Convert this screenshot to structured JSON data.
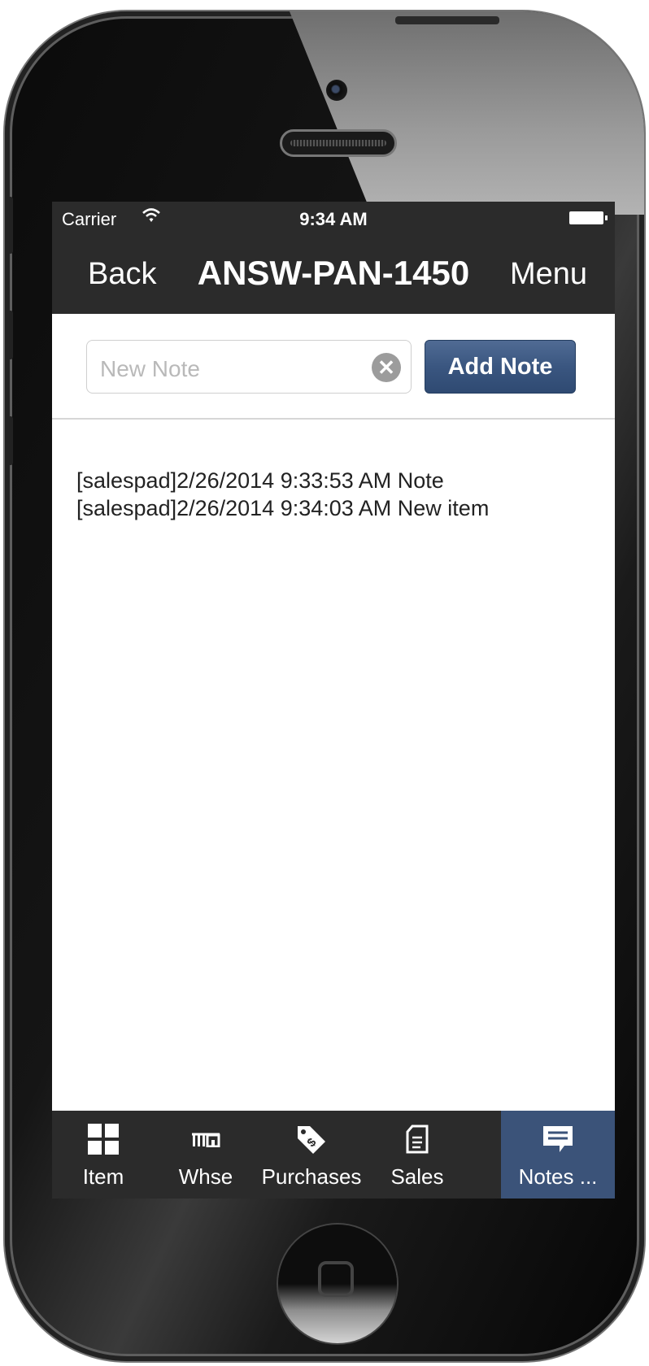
{
  "status_bar": {
    "carrier": "Carrier",
    "time": "9:34 AM"
  },
  "nav": {
    "back_label": "Back",
    "title": "ANSW-PAN-1450",
    "menu_label": "Menu"
  },
  "note_form": {
    "placeholder": "New Note",
    "clear_icon": "clear-icon",
    "add_label": "Add Note"
  },
  "notes": [
    "[salespad]2/26/2014 9:33:53 AM Note",
    "[salespad]2/26/2014 9:34:03 AM New item"
  ],
  "tabs": [
    {
      "label": "Item",
      "icon": "grid-icon"
    },
    {
      "label": "Whse",
      "icon": "warehouse-icon"
    },
    {
      "label": "Purchases",
      "icon": "price-tag-icon"
    },
    {
      "label": "Sales",
      "icon": "document-icon"
    },
    {
      "label": "Notes ...",
      "icon": "comment-icon",
      "active": true
    }
  ],
  "colors": {
    "bar": "#2b2b2b",
    "accent": "#3b5379"
  }
}
